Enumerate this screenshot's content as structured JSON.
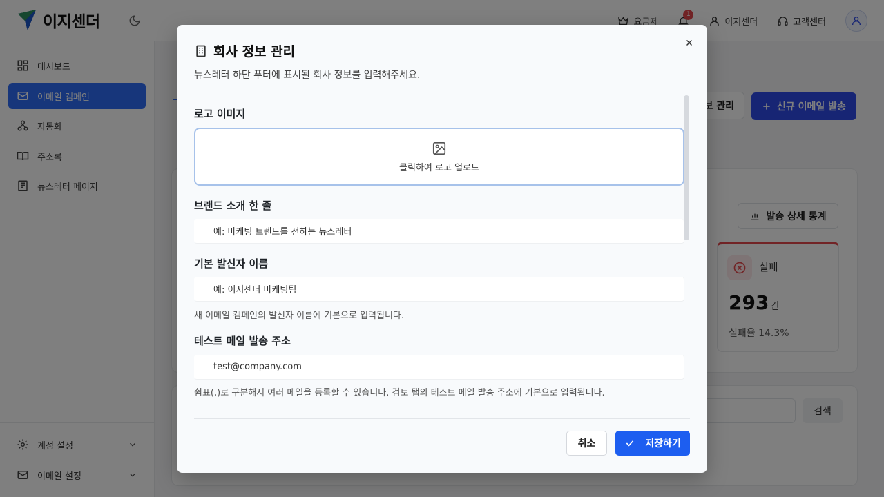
{
  "app": {
    "name": "이지센더"
  },
  "topbar": {
    "pricing": "요금제",
    "notifications_count": "1",
    "account": "이지센더",
    "support": "고객센터"
  },
  "sidebar": {
    "items": [
      {
        "label": "대시보드",
        "icon": "dashboard-icon"
      },
      {
        "label": "이메일 캠페인",
        "icon": "mail-icon",
        "active": true
      },
      {
        "label": "자동화",
        "icon": "automation-icon"
      },
      {
        "label": "주소록",
        "icon": "book-icon"
      },
      {
        "label": "뉴스레터 페이지",
        "icon": "newspaper-icon"
      }
    ],
    "settings": [
      {
        "label": "계정 설정"
      },
      {
        "label": "이메일 설정"
      }
    ]
  },
  "background": {
    "manage_button": "보 관리",
    "new_email_button": "신규 이메일 발송",
    "stats_button": "발송 상세 통계",
    "fail_card": {
      "label": "실패",
      "count": "293",
      "unit": "건",
      "rate": "실패율 14.3%"
    },
    "search_button": "검색"
  },
  "modal": {
    "title": "회사 정보 관리",
    "description": "뉴스레터 하단 푸터에 표시될 회사 정보를 입력해주세요.",
    "logo": {
      "label": "로고 이미지",
      "upload_text": "클릭하여 로고 업로드"
    },
    "brand_intro": {
      "label": "브랜드 소개 한 줄",
      "placeholder": "예: 마케팅 트렌드를 전하는 뉴스레터"
    },
    "sender_name": {
      "label": "기본 발신자 이름",
      "placeholder": "예: 이지센더 마케팅팀",
      "hint": "새 이메일 캠페인의 발신자 이름에 기본으로 입력됩니다."
    },
    "test_email": {
      "label": "테스트 메일 발송 주소",
      "placeholder": "test@company.com",
      "hint": "쉼표(,)로 구분해서 여러 메일을 등록할 수 있습니다. 검토 탭의 테스트 메일 발송 주소에 기본으로 입력됩니다."
    },
    "cancel_button": "취소",
    "save_button": "저장하기"
  },
  "colors": {
    "accent": "#1d5ef0",
    "sidebar_active": "#2f6df6",
    "danger": "#e5484d"
  }
}
